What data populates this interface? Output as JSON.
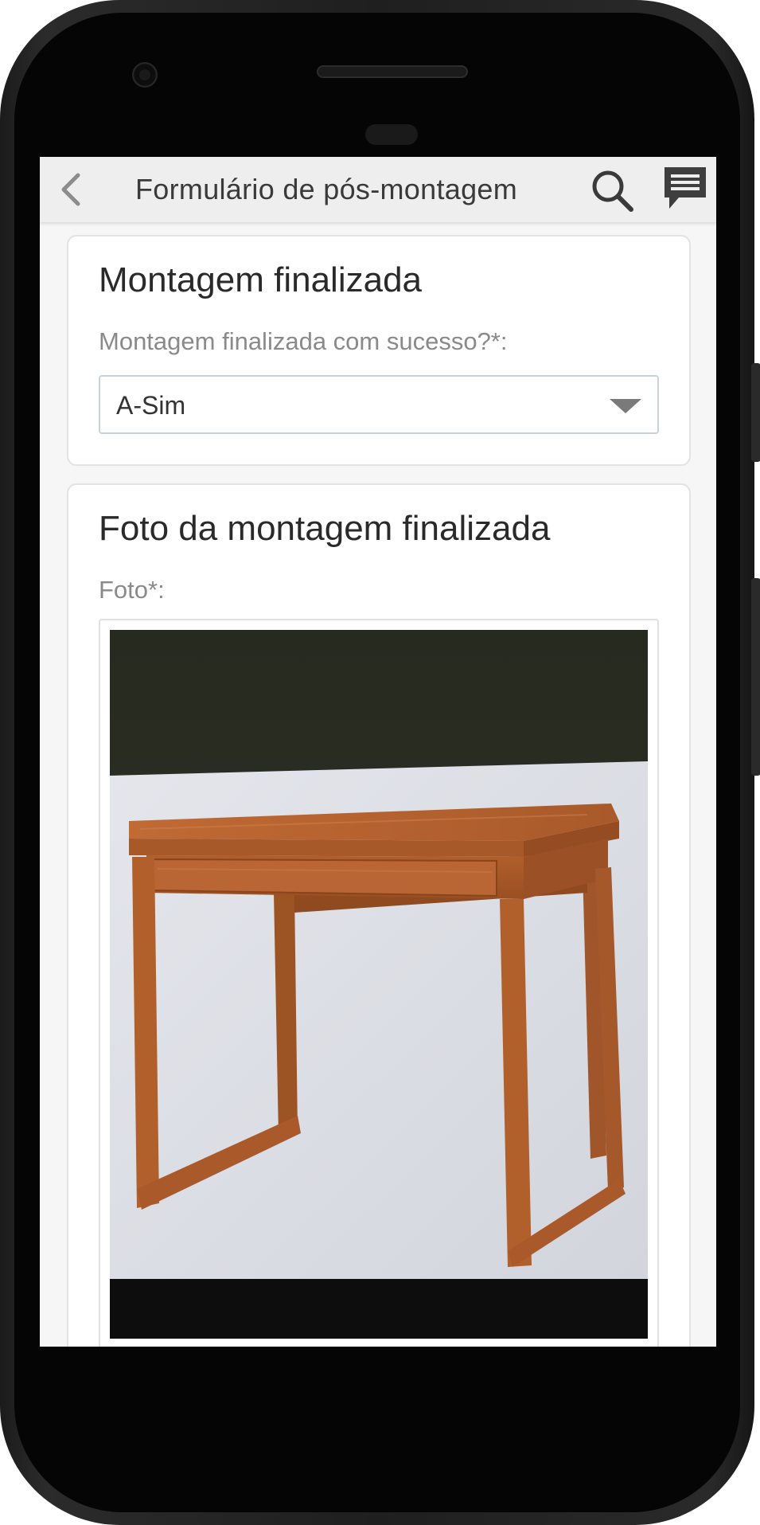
{
  "header": {
    "title": "Formulário de pós-montagem",
    "back_icon": "chevron-left-icon",
    "search_icon": "search-icon",
    "chat_icon": "message-icon"
  },
  "sections": [
    {
      "title": "Montagem finalizada",
      "field_label": "Montagem finalizada com sucesso?*:",
      "select_value": "A-Sim"
    },
    {
      "title": "Foto da montagem finalizada",
      "field_label": "Foto*:",
      "photo_subject": "wooden-desk-photo"
    }
  ],
  "colors": {
    "background": "#f6f6f6",
    "header_bg": "#eeeeee",
    "card_bg": "#ffffff",
    "label_gray": "#8a8a8a",
    "wood": "#b8652f"
  }
}
